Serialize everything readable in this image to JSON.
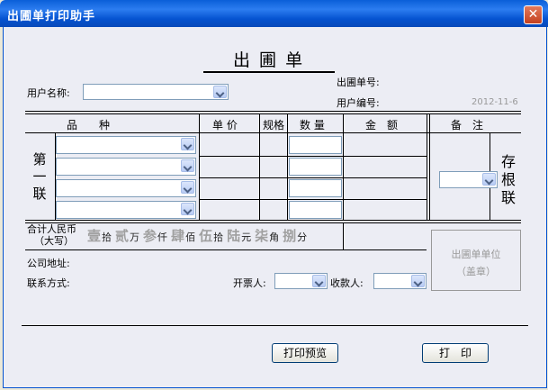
{
  "window": {
    "title": "出圃单打印助手",
    "close_glyph": "✕"
  },
  "form": {
    "title": "出 圃 单",
    "user_name_label": "用户名称:",
    "order_no_label": "出圃单号:",
    "user_no_label": "用户编号:",
    "date": "2012-11-6"
  },
  "table": {
    "headers": [
      "品　　种",
      "单 价",
      "规格",
      "数 量",
      "金　额",
      "备　注"
    ],
    "left_vertical": "第一联",
    "right_vertical": "存根联"
  },
  "total": {
    "label_line1": "合计人民币",
    "label_line2": "（大写）",
    "items": [
      {
        "digit": "壹",
        "unit": "拾"
      },
      {
        "digit": "贰",
        "unit": "万"
      },
      {
        "digit": "参",
        "unit": "仟"
      },
      {
        "digit": "肆",
        "unit": "佰"
      },
      {
        "digit": "伍",
        "unit": "拾"
      },
      {
        "digit": "陆",
        "unit": "元"
      },
      {
        "digit": "柒",
        "unit": "角"
      },
      {
        "digit": "捌",
        "unit": "分"
      }
    ]
  },
  "footer": {
    "address_label": "公司地址:",
    "contact_label": "联系方式:",
    "issuer_label": "开票人:",
    "payee_label": "收款人:",
    "stamp_line1": "出圃单单位",
    "stamp_line2": "（盖章）"
  },
  "buttons": {
    "preview": "打印预览",
    "print": "打　印"
  },
  "icons": {
    "dropdown": "chevron-down-icon",
    "close": "close-icon"
  }
}
